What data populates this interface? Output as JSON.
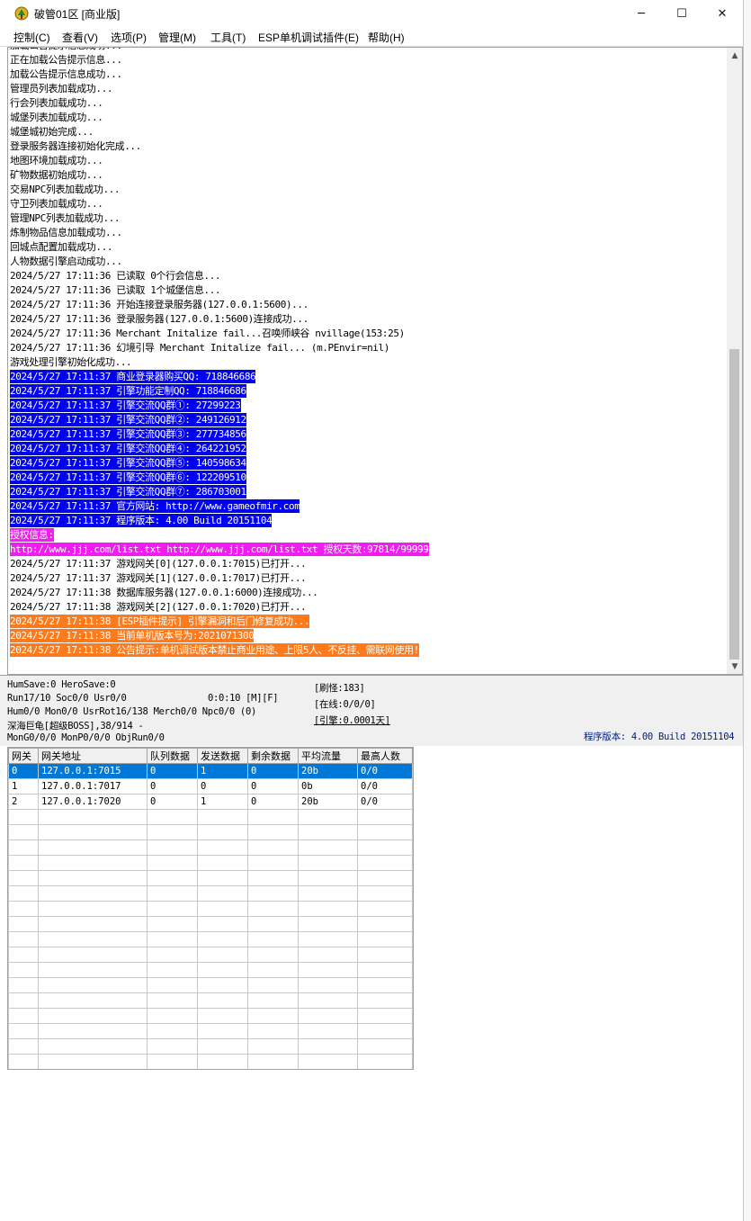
{
  "window": {
    "title": "破管01区 [商业版]",
    "controls": {
      "minimize": "─",
      "maximize": "☐",
      "close": "✕"
    }
  },
  "menu": [
    "控制(C)",
    "查看(V)",
    "选项(P)",
    "管理(M)",
    "工具(T)",
    "ESP单机调试插件(E)",
    "帮助(H)"
  ],
  "log": [
    {
      "text": "加载公告提示信息成功...",
      "style": ""
    },
    {
      "text": "正在加载公告提示信息...",
      "style": ""
    },
    {
      "text": "加载公告提示信息成功...",
      "style": ""
    },
    {
      "text": "管理员列表加载成功...",
      "style": ""
    },
    {
      "text": "行会列表加载成功...",
      "style": ""
    },
    {
      "text": "城堡列表加载成功...",
      "style": ""
    },
    {
      "text": "城堡城初始完成...",
      "style": ""
    },
    {
      "text": "登录服务器连接初始化完成...",
      "style": ""
    },
    {
      "text": "地图环境加载成功...",
      "style": ""
    },
    {
      "text": "矿物数据初始成功...",
      "style": ""
    },
    {
      "text": "交易NPC列表加载成功...",
      "style": ""
    },
    {
      "text": "守卫列表加载成功...",
      "style": ""
    },
    {
      "text": "管理NPC列表加载成功...",
      "style": ""
    },
    {
      "text": "炼制物品信息加载成功...",
      "style": ""
    },
    {
      "text": "回城点配置加载成功...",
      "style": ""
    },
    {
      "text": "人物数据引擎启动成功...",
      "style": ""
    },
    {
      "text": "2024/5/27 17:11:36 已读取 0个行会信息...",
      "style": ""
    },
    {
      "text": "2024/5/27 17:11:36 已读取 1个城堡信息...",
      "style": ""
    },
    {
      "text": "2024/5/27 17:11:36 开始连接登录服务器(127.0.0.1:5600)...",
      "style": ""
    },
    {
      "text": "2024/5/27 17:11:36 登录服务器(127.0.0.1:5600)连接成功...",
      "style": ""
    },
    {
      "text": "2024/5/27 17:11:36 Merchant Initalize fail...召唤师峡谷 nvillage(153:25)",
      "style": ""
    },
    {
      "text": "2024/5/27 17:11:36 幻境引导 Merchant Initalize fail... (m.PEnvir=nil)",
      "style": ""
    },
    {
      "text": "游戏处理引擎初始化成功...",
      "style": ""
    },
    {
      "text": "2024/5/27 17:11:37 商业登录器购买QQ: 718846686",
      "style": "hl-blue"
    },
    {
      "text": "2024/5/27 17:11:37 引擎功能定制QQ: 718846686",
      "style": "hl-blue"
    },
    {
      "text": "2024/5/27 17:11:37 引擎交流QQ群①: 27299223",
      "style": "hl-blue"
    },
    {
      "text": "2024/5/27 17:11:37 引擎交流QQ群②: 249126912",
      "style": "hl-blue"
    },
    {
      "text": "2024/5/27 17:11:37 引擎交流QQ群③: 277734856",
      "style": "hl-blue"
    },
    {
      "text": "2024/5/27 17:11:37 引擎交流QQ群④: 264221952",
      "style": "hl-blue"
    },
    {
      "text": "2024/5/27 17:11:37 引擎交流QQ群⑤: 140598634",
      "style": "hl-blue"
    },
    {
      "text": "2024/5/27 17:11:37 引擎交流QQ群⑥: 122209510",
      "style": "hl-blue"
    },
    {
      "text": "2024/5/27 17:11:37 引擎交流QQ群⑦: 286703001",
      "style": "hl-blue"
    },
    {
      "text": "2024/5/27 17:11:37 官方网站: http://www.gameofmir.com",
      "style": "hl-blue"
    },
    {
      "text": "2024/5/27 17:11:37 程序版本: 4.00 Build 20151104",
      "style": "hl-blue"
    },
    {
      "text": "授权信息:",
      "style": "hl-magenta"
    },
    {
      "text": "http://www.jjj.com/list.txt http://www.jjj.com/list.txt 授权天数:97814/99999",
      "style": "hl-magenta"
    },
    {
      "text": "2024/5/27 17:11:37 游戏网关[0](127.0.0.1:7015)已打开...",
      "style": ""
    },
    {
      "text": "2024/5/27 17:11:37 游戏网关[1](127.0.0.1:7017)已打开...",
      "style": ""
    },
    {
      "text": "2024/5/27 17:11:38 数据库服务器(127.0.0.1:6000)连接成功...",
      "style": ""
    },
    {
      "text": "2024/5/27 17:11:38 游戏网关[2](127.0.0.1:7020)已打开...",
      "style": ""
    },
    {
      "text": "2024/5/27 17:11:38 [ESP插件提示] 引擎漏洞和后门修复成功...",
      "style": "hl-orange"
    },
    {
      "text": "2024/5/27 17:11:38 当前单机版本号为:2021071300",
      "style": "hl-orange"
    },
    {
      "text": "2024/5/27 17:11:38 公告提示:单机调试版本禁止商业用途、上限5人、不反挂、需联网使用!",
      "style": "hl-orange"
    }
  ],
  "status": {
    "hum_save": "HumSave:0 HeroSave:0",
    "run": "Run17/10 Soc0/0 Usr0/0",
    "timer": "0:0:10 [M][F]",
    "hum": "Hum0/0 Mon0/0 UsrRot16/138 Merch0/0 Npc0/0 (0)",
    "boss": "深海巨龟[超级BOSS],38/914 -",
    "mong": "MonG0/0/0 MonP0/0/0 ObjRun0/0",
    "refresh": "[刷怪:183]",
    "online": "[在线:0/0/0]",
    "engine": "[引擎:0.0001天]",
    "version": "程序版本: 4.00 Build 20151104"
  },
  "grid": {
    "headers": [
      "网关",
      "网关地址",
      "队列数据",
      "发送数据",
      "剩余数据",
      "平均流量",
      "最高人数"
    ],
    "rows": [
      [
        "0",
        "127.0.0.1:7015",
        "0",
        "1",
        "0",
        "20b",
        "0/0"
      ],
      [
        "1",
        "127.0.0.1:7017",
        "0",
        "0",
        "0",
        "0b",
        "0/0"
      ],
      [
        "2",
        "127.0.0.1:7020",
        "0",
        "1",
        "0",
        "20b",
        "0/0"
      ]
    ],
    "selected_row": 0,
    "empty_rows": 17
  }
}
